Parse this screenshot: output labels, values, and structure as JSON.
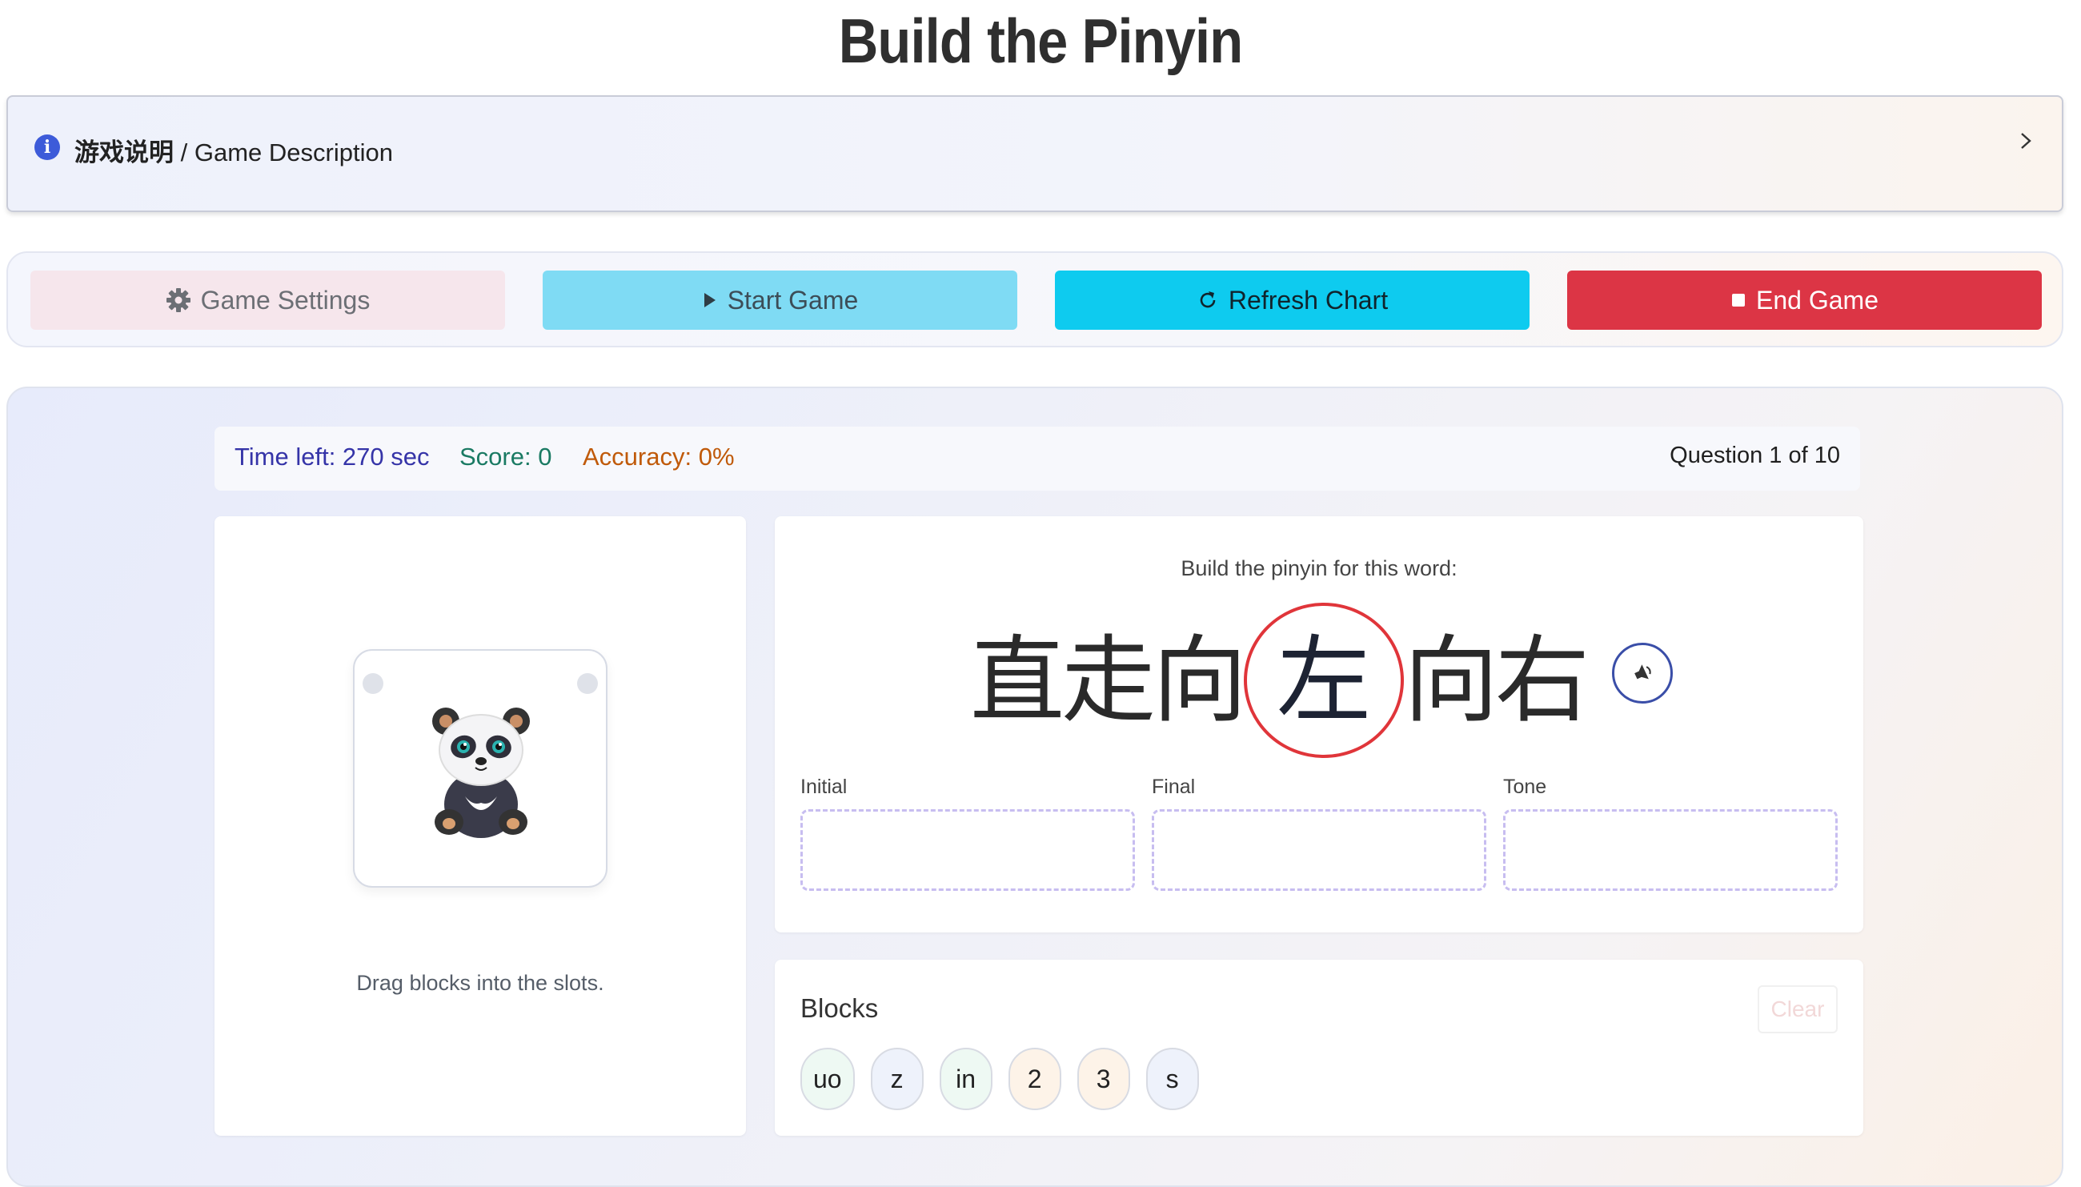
{
  "page": {
    "title": "Build the Pinyin"
  },
  "description": {
    "label_cn": "游戏说明",
    "label_sep": " / ",
    "label_en": "Game Description"
  },
  "controls": {
    "settings_label": "Game Settings",
    "start_label": "Start Game",
    "refresh_label": "Refresh Chart",
    "end_label": "End Game"
  },
  "stats": {
    "time_left": "Time left: 270 sec",
    "score": "Score: 0",
    "accuracy": "Accuracy: 0%",
    "question": "Question 1 of 10"
  },
  "mascot": {
    "hint": "Drag blocks into the slots."
  },
  "word": {
    "prompt": "Build the pinyin for this word:",
    "characters": [
      "直",
      "走",
      "向",
      "左",
      "向",
      "右"
    ],
    "target_index": 3
  },
  "slots": {
    "initial": "Initial",
    "final": "Final",
    "tone": "Tone"
  },
  "blocks": {
    "title": "Blocks",
    "clear_label": "Clear",
    "items": [
      {
        "text": "uo",
        "bg": "#eef9f3"
      },
      {
        "text": "z",
        "bg": "#eef2fb"
      },
      {
        "text": "in",
        "bg": "#eef9f3"
      },
      {
        "text": "2",
        "bg": "#fdf3e8"
      },
      {
        "text": "3",
        "bg": "#fdf3e8"
      },
      {
        "text": "s",
        "bg": "#eef2fb"
      }
    ]
  },
  "colors": {
    "accent_blue": "#3d5bd9",
    "end_red": "#dc3545",
    "refresh_cyan": "#0ecbef",
    "target_circle": "#e0353a"
  }
}
